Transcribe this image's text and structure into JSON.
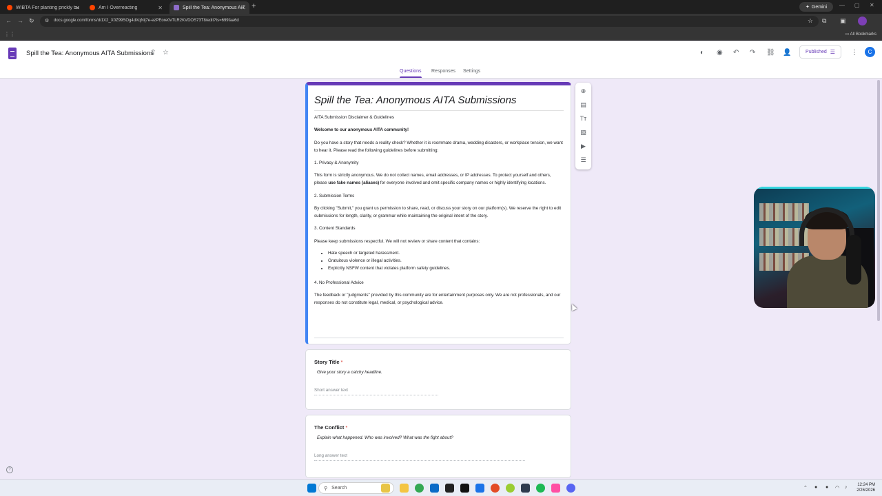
{
  "browser": {
    "tabs": [
      {
        "label": "WIBTA For planting prickly bu",
        "favicon_color": "#ff4500"
      },
      {
        "label": "Am I Overreacting",
        "favicon_color": "#ff4500"
      },
      {
        "label": "Spill the Tea: Anonymous AITA",
        "favicon_color": "#8e6cc9"
      }
    ],
    "new_tab": "+",
    "gemini_label": "Gemini",
    "url": "docs.google.com/forms/d/1X2_X0Z99SOg4dXqNij7e-ezPEore0vTLR2KVDOS73T8/edit?ts=699faa6d",
    "all_bookmarks": "All Bookmarks"
  },
  "forms": {
    "doc_title": "Spill the Tea: Anonymous AITA Submissions",
    "publish_label": "Published",
    "avatar_letter": "C",
    "tabs": [
      "Questions",
      "Responses",
      "Settings"
    ],
    "accent_color": "#673ab7"
  },
  "form": {
    "title": "Spill the Tea: Anonymous AITA Submissions",
    "subtitle": "AITA Submission Disclaimer & Guidelines",
    "welcome": "Welcome to our anonymous AITA community!",
    "intro": "Do you have a story that needs a reality check? Whether it is roommate drama, wedding disasters, or workplace tension, we want to hear it. Please read the following guidelines before submitting:",
    "s1_heading": "1. Privacy & Anonymity",
    "s1_text_a": "This form is strictly anonymous. We do not collect names, email addresses, or IP addresses. To protect yourself and others, please ",
    "s1_text_bold": "use fake names (aliases)",
    "s1_text_b": " for everyone involved and omit specific company names or highly identifying locations.",
    "s2_heading": "2. Submission Terms",
    "s2_text": "By clicking \"Submit,\" you grant us permission to share, read, or discuss your story on our platform(s). We reserve the right to edit submissions for length, clarity, or grammar while maintaining the original intent of the story.",
    "s3_heading": "3. Content Standards",
    "s3_text": "Please keep submissions respectful. We will not review or share content that contains:",
    "s3_list": [
      "Hate speech or targeted harassment.",
      "Gratuitous violence or illegal activities.",
      "Explicitly NSFW content that violates platform safety guidelines."
    ],
    "s4_heading": "4. No Professional Advice",
    "s4_text": "The feedback or \"judgments\" provided by this community are for entertainment purposes only. We are not professionals, and our responses do not constitute legal, medical, or psychological advice.",
    "questions": [
      {
        "title": "Story Title",
        "required": "*",
        "description": "Give your story a catchy headline.",
        "placeholder": "Short answer text"
      },
      {
        "title": "The Conflict",
        "required": "*",
        "description": "Explain what happened. Who was involved? What was the fight about?",
        "placeholder": "Long answer text"
      }
    ]
  },
  "taskbar": {
    "search_label": "Search",
    "time": "12:24 PM",
    "date": "2/26/2026"
  }
}
